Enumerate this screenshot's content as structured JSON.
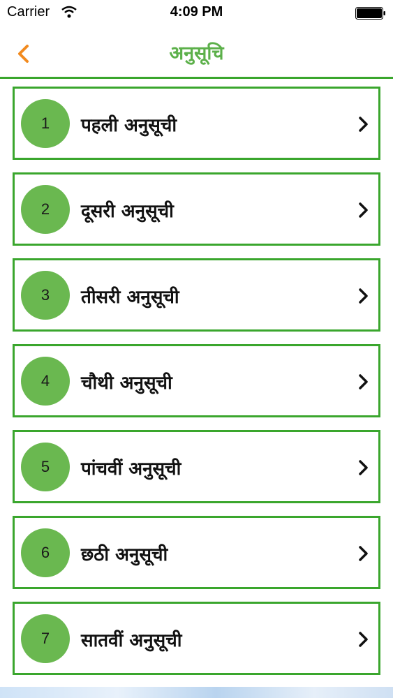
{
  "status_bar": {
    "carrier": "Carrier",
    "time": "4:09 PM"
  },
  "nav": {
    "title": "अनुसूचि",
    "back_icon": "chevron-left-icon"
  },
  "colors": {
    "accent_green": "#3aa62d",
    "circle_green": "#6ab850",
    "back_orange": "#f28a1e"
  },
  "items": [
    {
      "number": "1",
      "label": "पहली अनुसूची"
    },
    {
      "number": "2",
      "label": "दूसरी अनुसूची"
    },
    {
      "number": "3",
      "label": "तीसरी अनुसूची"
    },
    {
      "number": "4",
      "label": "चौथी अनुसूची"
    },
    {
      "number": "5",
      "label": "पांचवीं अनुसूची"
    },
    {
      "number": "6",
      "label": "छठी अनुसूची"
    },
    {
      "number": "7",
      "label": "सातवीं अनुसूची"
    }
  ]
}
